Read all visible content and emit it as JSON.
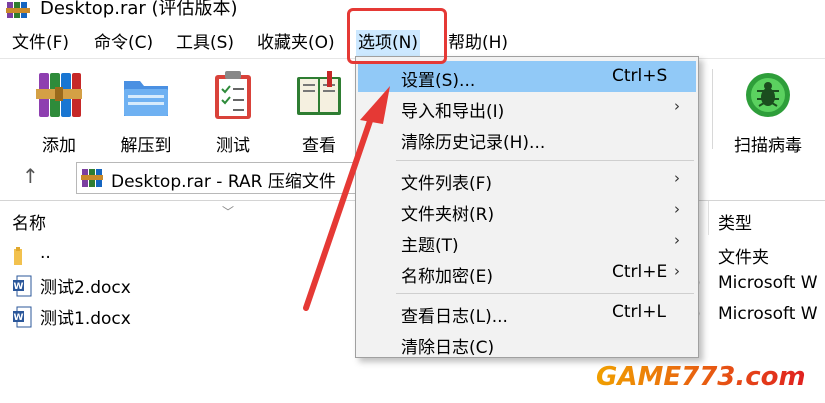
{
  "window": {
    "title": "Desktop.rar (评估版本)"
  },
  "menubar": {
    "items": [
      {
        "label": "文件(F)"
      },
      {
        "label": "命令(C)"
      },
      {
        "label": "工具(S)"
      },
      {
        "label": "收藏夹(O)"
      },
      {
        "label": "选项(N)"
      },
      {
        "label": "帮助(H)"
      }
    ],
    "active": "选项(N)"
  },
  "toolbar": {
    "buttons": [
      {
        "label": "添加",
        "icon": "add-archive-icon"
      },
      {
        "label": "解压到",
        "icon": "extract-folder-icon"
      },
      {
        "label": "测试",
        "icon": "test-clipboard-icon"
      },
      {
        "label": "查看",
        "icon": "view-book-icon"
      },
      {
        "label": "扫描病毒",
        "icon": "virus-scan-bug-icon"
      }
    ]
  },
  "address": {
    "path": "Desktop.rar - RAR 压缩文件"
  },
  "filelist": {
    "columns": {
      "name": "名称",
      "type": "类型"
    },
    "rows": [
      {
        "name": "..",
        "type": "文件夹",
        "icon": "folder-icon"
      },
      {
        "name": "测试2.docx",
        "type": "Microsoft W",
        "icon": "word-doc-icon"
      },
      {
        "name": "测试1.docx",
        "type": "Microsoft W",
        "icon": "word-doc-icon"
      }
    ]
  },
  "options_menu": {
    "items": [
      {
        "label": "设置(S)...",
        "shortcut": "Ctrl+S",
        "selected": true
      },
      {
        "label": "导入和导出(I)",
        "submenu": true
      },
      {
        "label": "清除历史记录(H)..."
      },
      {
        "label": "文件列表(F)",
        "submenu": true
      },
      {
        "label": "文件夹树(R)",
        "submenu": true
      },
      {
        "label": "主题(T)",
        "submenu": true
      },
      {
        "label": "名称加密(E)",
        "shortcut": "Ctrl+E",
        "submenu": true
      },
      {
        "label": "查看日志(L)...",
        "shortcut": "Ctrl+L"
      },
      {
        "label": "清除日志(C)"
      }
    ]
  },
  "watermark": {
    "text": "GAME773.com"
  },
  "colors": {
    "selection": "#91c9f7",
    "menu_bg": "#f2f2f2",
    "annotation_red": "#e53935",
    "watermark_start": "#f0a000",
    "watermark_end": "#e02020"
  }
}
